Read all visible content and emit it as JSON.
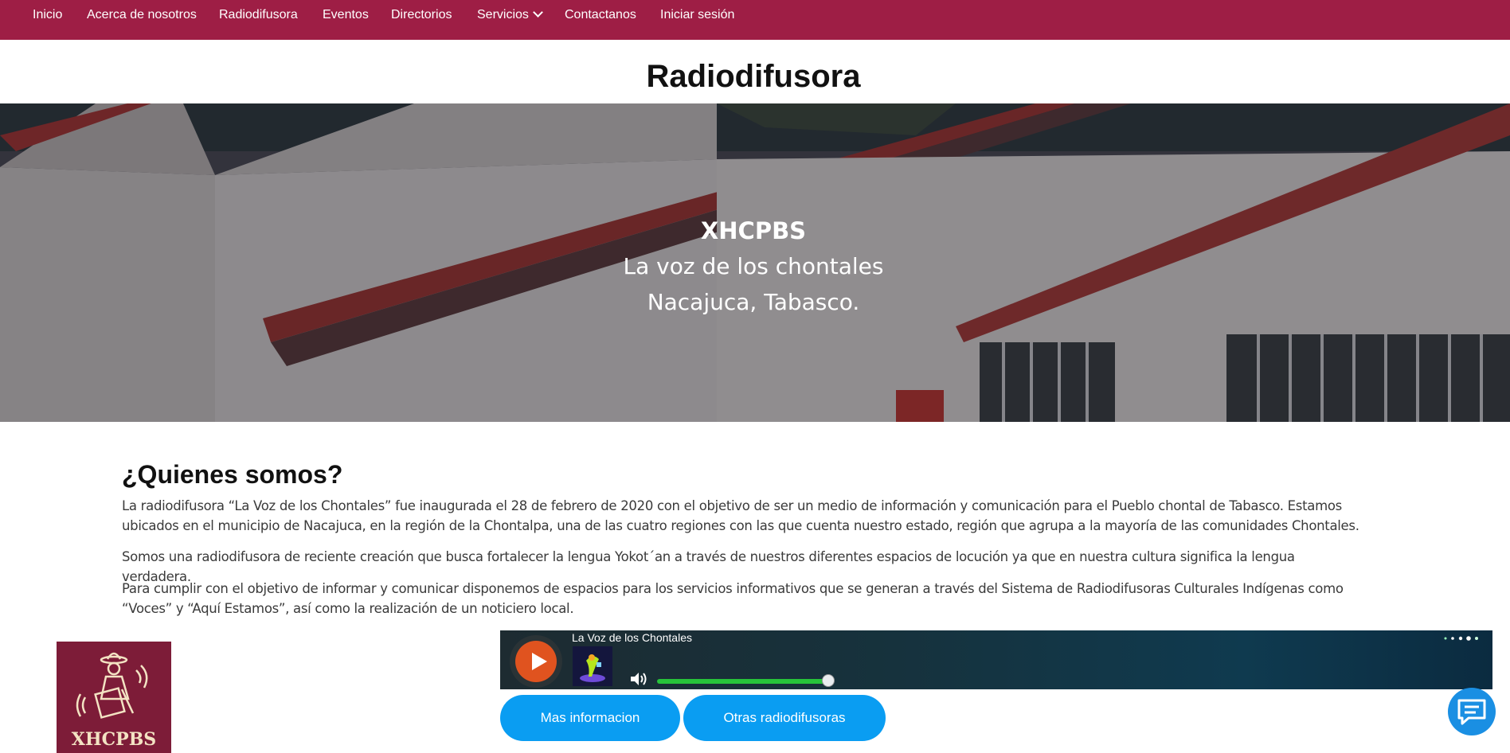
{
  "nav": {
    "items": [
      {
        "label": "Inicio"
      },
      {
        "label": "Acerca de nosotros"
      },
      {
        "label": "Radiodifusora"
      },
      {
        "label": "Eventos"
      },
      {
        "label": "Directorios"
      },
      {
        "label": "Servicios"
      },
      {
        "label": "Contactanos"
      },
      {
        "label": "Iniciar sesión"
      }
    ],
    "background": "#9e1e45"
  },
  "page": {
    "title": "Radiodifusora"
  },
  "hero": {
    "call_sign": "XHCPBS",
    "line1": "La voz de los chontales",
    "line2": "Nacajuca, Tabasco."
  },
  "about": {
    "title": "¿Quienes somos?",
    "paragraphs": [
      "La radiodifusora “La Voz de los Chontales” fue inaugurada el 28 de febrero de 2020 con el objetivo de ser un medio de información y comunicación para el Pueblo chontal de Tabasco. Estamos ubicados en el municipio de Nacajuca, en la región de la Chontalpa, una de las cuatro regiones con las que cuenta nuestro estado, región que agrupa a la mayoría de las comunidades Chontales.",
      "Somos una radiodifusora de reciente creación que busca fortalecer la lengua Yokot´an a través de nuestros diferentes espacios de locución ya que en nuestra cultura significa la lengua verdadera.",
      "Para cumplir con el objetivo de informar y comunicar disponemos de espacios para los servicios informativos que se generan a través del Sistema de Radiodifusoras Culturales Indígenas como “Voces” y “Aquí Estamos”, así como la realización de un noticiero local."
    ]
  },
  "logo": {
    "text": "XHCPBS"
  },
  "player": {
    "station_name": "La Voz de los Chontales",
    "volume": 0.97,
    "play_color": "#e0531f",
    "volume_color": "#27c33a"
  },
  "buttons": {
    "more_info": "Mas informacion",
    "other_stations": "Otras radiodifusoras",
    "color": "#0a9df2"
  },
  "chat": {
    "icon": "chat-icon"
  }
}
